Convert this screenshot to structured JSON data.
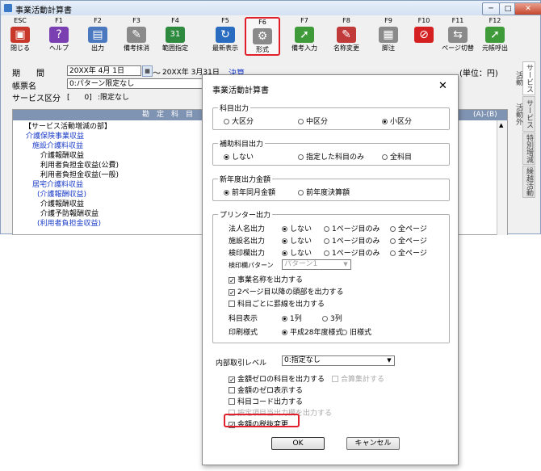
{
  "window": {
    "title": "事業活動計算書",
    "min": "─",
    "max": "□",
    "close": "✕"
  },
  "toolbar": [
    {
      "key": "ESC",
      "label": "閉じる",
      "icon": "close-window-icon",
      "glyph": "▣",
      "color": "#c8382a"
    },
    {
      "key": "F1",
      "label": "ヘルプ",
      "icon": "help-icon",
      "glyph": "?",
      "color": "#7a3fb0"
    },
    {
      "key": "F2",
      "label": "出力",
      "icon": "output-icon",
      "glyph": "▤",
      "color": "#4a79c0"
    },
    {
      "key": "F3",
      "label": "備考抹消",
      "icon": "erase-note-icon",
      "glyph": "✎",
      "color": "#8a8a8a"
    },
    {
      "key": "F4",
      "label": "範囲指定",
      "icon": "calendar-icon",
      "glyph": "31",
      "color": "#2e8a3e"
    },
    {
      "key": "F5",
      "label": "最新表示",
      "icon": "refresh-icon",
      "glyph": "↻",
      "color": "#2a6cc0"
    },
    {
      "key": "F6",
      "label": "形式",
      "icon": "gear-icon",
      "glyph": "⚙",
      "color": "#8a8a8a"
    },
    {
      "key": "F7",
      "label": "備考入力",
      "icon": "note-input-icon",
      "glyph": "➚",
      "color": "#3f9a3a"
    },
    {
      "key": "F8",
      "label": "名称変更",
      "icon": "rename-icon",
      "glyph": "✎",
      "color": "#c03a3a"
    },
    {
      "key": "F9",
      "label": "脚注",
      "icon": "footnote-icon",
      "glyph": "▦",
      "color": "#8a8a8a"
    },
    {
      "key": "F10",
      "label": "",
      "icon": "prohibit-icon",
      "glyph": "⊘",
      "color": "#d42020"
    },
    {
      "key": "F11",
      "label": "ページ切替",
      "icon": "page-switch-icon",
      "glyph": "⇆",
      "color": "#8a8a8a"
    },
    {
      "key": "F12",
      "label": "元帳呼出",
      "icon": "ledger-call-icon",
      "glyph": "➚",
      "color": "#3f9a3a"
    }
  ],
  "header": {
    "period_label": "期　　間",
    "period_from": "20XX年 4月 1日",
    "period_sep": "〜",
    "period_to": "20XX年 3月31日",
    "settle_label": "決算",
    "unit": "(単位：円)",
    "form_name_label": "帳票名",
    "form_name_value": "0:パターン限定なし",
    "service_label": "サービス区分",
    "service_code": "[　　0]",
    "service_value": ":限定なし"
  },
  "side_tabs": [
    "サービス活動",
    "サービス活動外",
    "特別増減",
    "繰越活動"
  ],
  "table": {
    "col_subject": "勘　定　科　目",
    "col_diff": "(A)-(B)",
    "rows": [
      {
        "text": "【サービス活動増減の部】",
        "indent": 14,
        "blue": false
      },
      {
        "text": "介護保険事業収益",
        "indent": 16,
        "blue": true
      },
      {
        "text": "施設介護料収益",
        "indent": 24,
        "blue": true
      },
      {
        "text": "介護報酬収益",
        "indent": 34,
        "blue": false
      },
      {
        "text": "利用者負担金収益(公費)",
        "indent": 34,
        "blue": false
      },
      {
        "text": "利用者負担金収益(一般)",
        "indent": 34,
        "blue": false
      },
      {
        "text": "居宅介護料収益",
        "indent": 24,
        "blue": true
      },
      {
        "text": "(介護報酬収益)",
        "indent": 30,
        "blue": true
      },
      {
        "text": "介護報酬収益",
        "indent": 34,
        "blue": false
      },
      {
        "text": "介護予防報酬収益",
        "indent": 34,
        "blue": false
      },
      {
        "text": "(利用者負担金収益)",
        "indent": 30,
        "blue": true
      }
    ]
  },
  "dialog": {
    "title": "事業活動計算書",
    "close": "✕",
    "subject_output": {
      "title": "科目出力",
      "options": [
        "大区分",
        "中区分",
        "小区分"
      ],
      "selected": 2
    },
    "aux_output": {
      "title": "補助科目出力",
      "options": [
        "しない",
        "指定した科目のみ",
        "全科目"
      ],
      "selected": 0
    },
    "newyear": {
      "title": "新年度出力金額",
      "options": [
        "前年同月金額",
        "前年度決算額"
      ],
      "selected": 0
    },
    "printer": {
      "title": "プリンター出力",
      "rows": [
        {
          "label": "法人名出力",
          "options": [
            "しない",
            "1ページ目のみ",
            "全ページ"
          ],
          "selected": 0
        },
        {
          "label": "施設名出力",
          "options": [
            "しない",
            "1ページ目のみ",
            "全ページ"
          ],
          "selected": 0
        },
        {
          "label": "検印欄出力",
          "options": [
            "しない",
            "1ページ目のみ",
            "全ページ"
          ],
          "selected": 0
        }
      ],
      "stamp_pattern_label": "検印欄パターン",
      "stamp_pattern_value": "パターン1",
      "checks": [
        {
          "label": "事業名称を出力する",
          "checked": true
        },
        {
          "label": "2ページ目以降の頭部を出力する",
          "checked": true
        },
        {
          "label": "科目ごとに罫線を出力する",
          "checked": false
        }
      ],
      "subject_display_label": "科目表示",
      "subject_display_options": [
        "1列",
        "3列"
      ],
      "subject_display_selected": 0,
      "print_style_label": "印刷様式",
      "print_style_options": [
        "平成28年度様式",
        "旧様式"
      ],
      "print_style_selected": 0
    },
    "internal_label": "内部取引レベル",
    "internal_value": "0:指定なし",
    "bottom_checks": [
      {
        "label": "金額ゼロの科目を出力する",
        "checked": true,
        "disabled": false
      },
      {
        "label": "金額のゼロ表示する",
        "checked": false,
        "disabled": false
      },
      {
        "label": "科目コード出力する",
        "checked": false,
        "disabled": false
      },
      {
        "label": "按定項目当出力欄を出力する",
        "checked": false,
        "disabled": true
      },
      {
        "label": "金額の税抜変更",
        "checked": true,
        "disabled": false
      }
    ],
    "sum_check": {
      "label": "合算集計する",
      "checked": false,
      "disabled": true
    },
    "ok": "OK",
    "cancel": "キャンセル"
  }
}
